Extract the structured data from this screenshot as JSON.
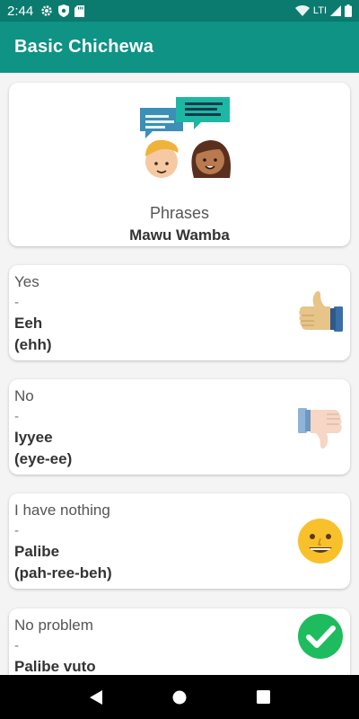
{
  "status_bar": {
    "time": "2:44",
    "network_label": "LTI",
    "icons": [
      "gear-icon",
      "shield-icon",
      "sd-card-icon",
      "wifi-icon",
      "signal-icon",
      "battery-icon"
    ]
  },
  "app_bar": {
    "title": "Basic Chichewa"
  },
  "header_card": {
    "label": "Phrases",
    "sublabel": "Mawu Wamba",
    "icon": "conversation-people-icon"
  },
  "phrases": [
    {
      "english": "Yes",
      "separator": "-",
      "chichewa": "Eeh",
      "pronunciation": "(ehh)",
      "icon": "thumbs-up-icon"
    },
    {
      "english": "No",
      "separator": "-",
      "chichewa": "Iyyee",
      "pronunciation": "(eye-ee)",
      "icon": "thumbs-down-icon"
    },
    {
      "english": "I have nothing",
      "separator": "-",
      "chichewa": "Palibe",
      "pronunciation": "(pah-ree-beh)",
      "icon": "smiley-face-icon"
    },
    {
      "english": "No problem",
      "separator": "-",
      "chichewa": "Palibe vuto",
      "pronunciation": "",
      "icon": "check-circle-icon"
    }
  ],
  "nav_bar": {
    "buttons": [
      "back-icon",
      "home-icon",
      "recents-icon"
    ]
  },
  "colors": {
    "status_bar": "#0b7b6f",
    "app_bar": "#0e9385",
    "background": "#f4f4f4"
  }
}
